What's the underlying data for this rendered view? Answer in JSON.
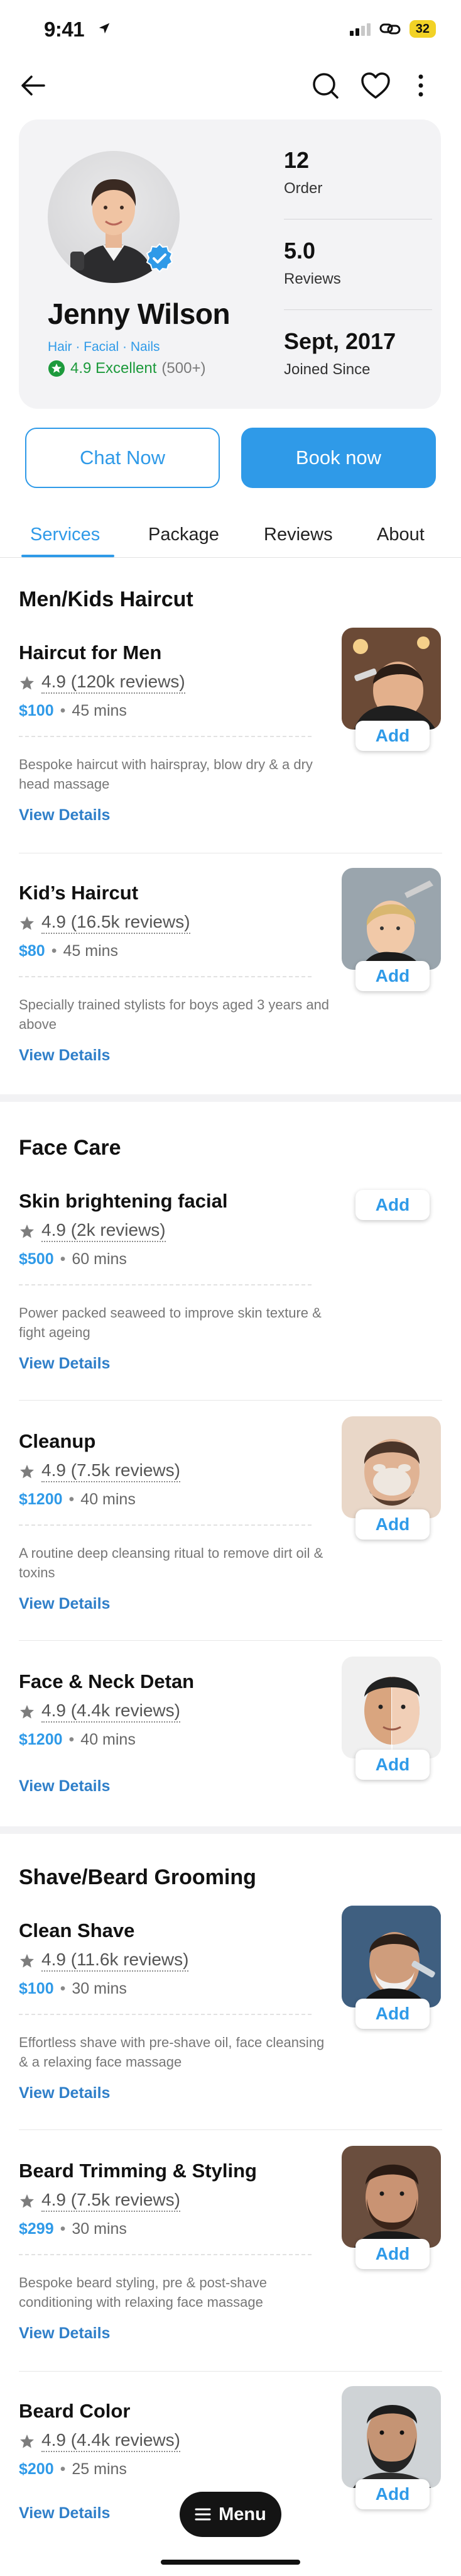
{
  "status": {
    "time": "9:41",
    "battery": "32"
  },
  "profile": {
    "name": "Jenny Wilson",
    "tags": "Hair · Facial · Nails",
    "rating_strong": "4.9 Excellent",
    "rating_count": "(500+)",
    "stats": [
      {
        "value": "12",
        "label": "Order"
      },
      {
        "value": "5.0",
        "label": "Reviews"
      },
      {
        "value": "Sept, 2017",
        "label": "Joined Since"
      }
    ]
  },
  "actions": {
    "chat": "Chat Now",
    "book": "Book now"
  },
  "tabs": [
    "Services",
    "Package",
    "Reviews",
    "About"
  ],
  "sections": [
    {
      "title": "Men/Kids Haircut",
      "services": [
        {
          "name": "Haircut for Men",
          "rating": "4.9 (120k reviews)",
          "price": "$100",
          "duration": "45 mins",
          "desc": "Bespoke haircut with hairspray, blow dry & a dry head massage",
          "details": "View Details",
          "add": "Add",
          "thumb": "barber-cut"
        },
        {
          "name": "Kid’s Haircut",
          "rating": "4.9 (16.5k reviews)",
          "price": "$80",
          "duration": "45 mins",
          "desc": "Specially trained stylists for boys aged 3 years and above",
          "details": "View Details",
          "add": "Add",
          "thumb": "kid-cut"
        }
      ]
    },
    {
      "title": "Face Care",
      "services": [
        {
          "name": "Skin brightening facial",
          "rating": "4.9 (2k reviews)",
          "price": "$500",
          "duration": "60 mins",
          "desc": "Power packed seaweed to improve skin texture & fight ageing",
          "details": "View Details",
          "add": "Add",
          "thumb": ""
        },
        {
          "name": "Cleanup",
          "rating": "4.9 (7.5k reviews)",
          "price": "$1200",
          "duration": "40 mins",
          "desc": "A routine deep cleansing ritual to remove dirt oil & toxins",
          "details": "View Details",
          "add": "Add",
          "thumb": "face-mask"
        },
        {
          "name": "Face & Neck Detan",
          "rating": "4.9 (4.4k reviews)",
          "price": "$1200",
          "duration": "40 mins",
          "desc": "",
          "details": "View Details",
          "add": "Add",
          "thumb": "detan"
        }
      ]
    },
    {
      "title": "Shave/Beard Grooming",
      "services": [
        {
          "name": "Clean Shave",
          "rating": "4.9 (11.6k reviews)",
          "price": "$100",
          "duration": "30 mins",
          "desc": "Effortless shave with pre-shave oil, face cleansing & a relaxing face massage",
          "details": "View Details",
          "add": "Add",
          "thumb": "shave"
        },
        {
          "name": "Beard Trimming & Styling",
          "rating": "4.9 (7.5k reviews)",
          "price": "$299",
          "duration": "30 mins",
          "desc": "Bespoke beard styling, pre & post-shave conditioning with relaxing face massage",
          "details": "View Details",
          "add": "Add",
          "thumb": "beard"
        },
        {
          "name": "Beard Color",
          "rating": "4.9 (4.4k reviews)",
          "price": "$200",
          "duration": "25 mins",
          "desc": "",
          "details": "View Details",
          "add": "Add",
          "thumb": "beard-color"
        }
      ]
    }
  ],
  "menu": {
    "label": "Menu"
  },
  "colors": {
    "accent": "#2f9ae8",
    "success": "#1d9a3c",
    "battery": "#f2d226"
  }
}
